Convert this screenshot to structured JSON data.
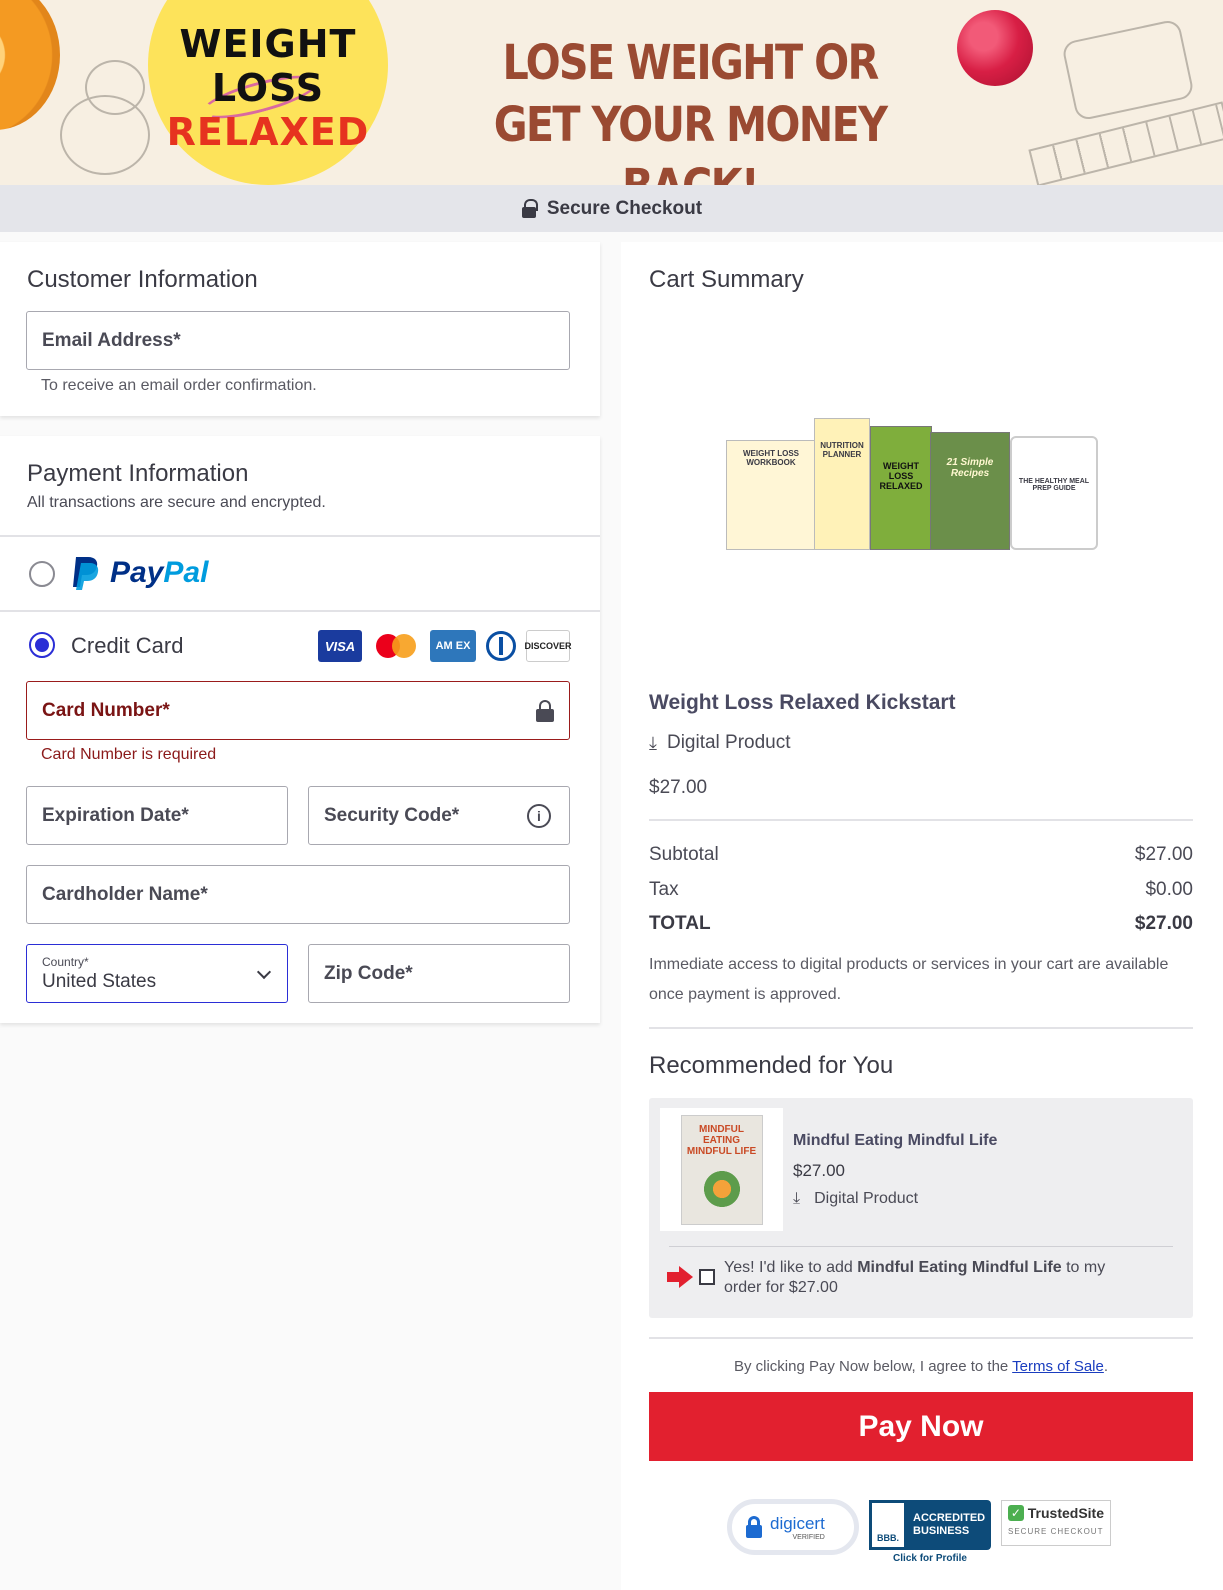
{
  "banner": {
    "logo_line1": "WEIGHT",
    "logo_line2": "LOSS",
    "logo_line3": "RELAXED",
    "headline_line1": "LOSE WEIGHT OR",
    "headline_line2": "GET YOUR MONEY BACK!"
  },
  "secure_bar": {
    "label": "Secure Checkout"
  },
  "customer": {
    "title": "Customer Information",
    "email_label": "Email Address*",
    "email_helper": "To receive an email order confirmation."
  },
  "payment": {
    "title": "Payment Information",
    "subtitle": "All transactions are secure and encrypted.",
    "paypal_label_pay": "Pay",
    "paypal_label_pal": "Pal",
    "credit_label": "Credit Card",
    "card_brands": {
      "visa": "VISA",
      "amex": "AM EX",
      "discover": "DISCOVER"
    },
    "card_number_label": "Card Number*",
    "card_number_error": "Card Number is required",
    "expiration_label": "Expiration Date*",
    "security_label": "Security Code*",
    "cardholder_label": "Cardholder Name*",
    "country_label": "Country*",
    "country_value": "United States",
    "zip_label": "Zip Code*",
    "selected_method": "Credit Card"
  },
  "cart": {
    "title": "Cart Summary",
    "product_images": [
      "WEIGHT LOSS WORKBOOK",
      "NUTRITION PLANNER",
      "WEIGHT LOSS RELAXED",
      "21 Simple Recipes",
      "THE HEALTHY MEAL PREP GUIDE"
    ],
    "product_name": "Weight Loss Relaxed Kickstart",
    "product_type": "Digital Product",
    "product_price": "$27.00",
    "subtotal_label": "Subtotal",
    "subtotal_value": "$27.00",
    "tax_label": "Tax",
    "tax_value": "$0.00",
    "total_label": "TOTAL",
    "total_value": "$27.00",
    "access_note": "Immediate access to digital products or services in your cart are available once payment is approved."
  },
  "recommended": {
    "title": "Recommended for You",
    "cover_text": "MINDFUL EATING MINDFUL LIFE",
    "item_name": "Mindful Eating Mindful Life",
    "item_price": "$27.00",
    "item_type": "Digital Product",
    "offer_prefix": "Yes! I'd like to add ",
    "offer_product": "Mindful Eating Mindful Life",
    "offer_suffix": " to my",
    "offer_line2": "order for $27.00",
    "checked": false
  },
  "terms": {
    "prefix": "By clicking Pay Now below, I agree to the ",
    "link": "Terms of Sale",
    "suffix": "."
  },
  "pay_button": {
    "label": "Pay Now"
  },
  "badges": {
    "digicert": "digicert",
    "digicert_sub": "VERIFIED",
    "bbb_line1": "ACCREDITED",
    "bbb_line2": "BUSINESS",
    "bbb_logo": "BBB.",
    "bbb_link": "Click for Profile",
    "trusted": "TrustedSite",
    "trusted_sub": "SECURE CHECKOUT"
  },
  "colors": {
    "accent_blue": "#2b2ed6",
    "error_red": "#8b1a1a",
    "pay_red": "#e2202f",
    "paypal_dark": "#003087",
    "paypal_light": "#009cde"
  }
}
